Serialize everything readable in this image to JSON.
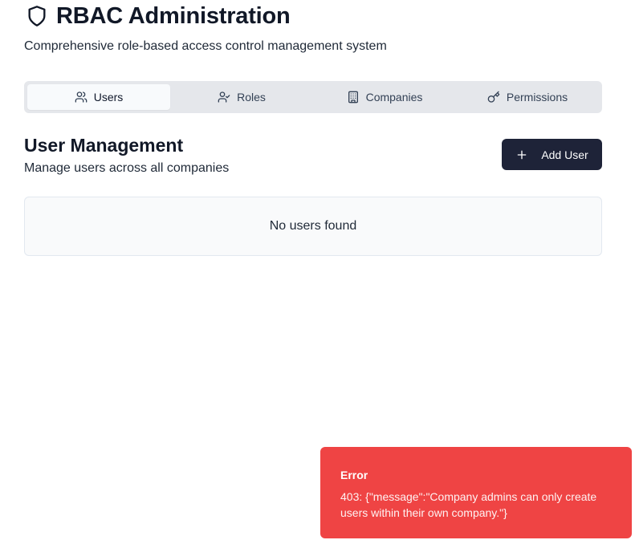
{
  "header": {
    "title": "RBAC Administration",
    "subtitle": "Comprehensive role-based access control management system",
    "icon": "shield-icon"
  },
  "tabs": [
    {
      "label": "Users",
      "icon": "users-icon",
      "active": true
    },
    {
      "label": "Roles",
      "icon": "user-check-icon",
      "active": false
    },
    {
      "label": "Companies",
      "icon": "building-icon",
      "active": false
    },
    {
      "label": "Permissions",
      "icon": "key-icon",
      "active": false
    }
  ],
  "section": {
    "title": "User Management",
    "description": "Manage users across all companies",
    "add_button_label": "Add User"
  },
  "empty_state": {
    "text": "No users found"
  },
  "toast": {
    "title": "Error",
    "message": "403: {\"message\":\"Company admins can only create users within their own company.\"}",
    "color": "#ef4444"
  },
  "colors": {
    "primary_button": "#1e2338",
    "tab_bar": "#e5e7eb",
    "error": "#ef4444"
  }
}
